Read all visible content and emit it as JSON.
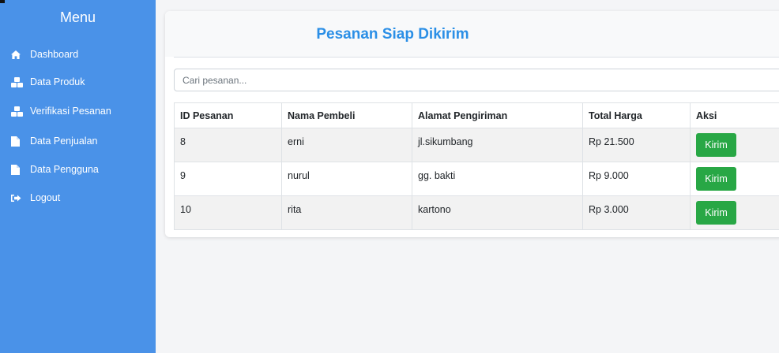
{
  "sidebar": {
    "title": "Menu",
    "items": [
      {
        "label": "Dashboard",
        "icon": "home-icon"
      },
      {
        "label": "Data Produk",
        "icon": "cubes-icon"
      },
      {
        "label": "Verifikasi Pesanan",
        "icon": "cubes-icon"
      },
      {
        "label": "Data Penjualan",
        "icon": "file-icon"
      },
      {
        "label": "Data Pengguna",
        "icon": "file-icon"
      },
      {
        "label": "Logout",
        "icon": "sign-out-icon"
      }
    ]
  },
  "main": {
    "title": "Pesanan Siap Dikirim",
    "search": {
      "placeholder": "Cari pesanan...",
      "value": ""
    },
    "table": {
      "headers": [
        "ID Pesanan",
        "Nama Pembeli",
        "Alamat Pengiriman",
        "Total Harga",
        "Aksi"
      ],
      "rows": [
        {
          "id": "8",
          "nama": "erni",
          "alamat": "jl.sikumbang",
          "total": "Rp 21.500",
          "aksi": "Kirim"
        },
        {
          "id": "9",
          "nama": "nurul",
          "alamat": "gg. bakti",
          "total": "Rp 9.000",
          "aksi": "Kirim"
        },
        {
          "id": "10",
          "nama": "rita",
          "alamat": "kartono",
          "total": "Rp 3.000",
          "aksi": "Kirim"
        }
      ]
    }
  },
  "colors": {
    "sidebar_bg": "#4a92e8",
    "title_blue": "#2b8fe6",
    "button_green": "#28a745"
  }
}
